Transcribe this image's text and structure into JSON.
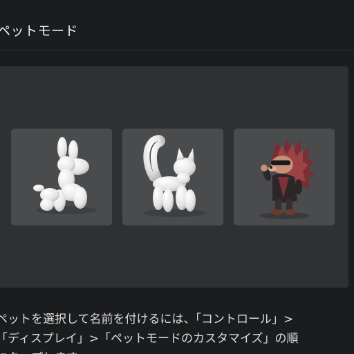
{
  "header": {
    "title": "ペットモード"
  },
  "pets": [
    {
      "id": "dog",
      "icon": "balloon-dog-pet-icon"
    },
    {
      "id": "cat",
      "icon": "balloon-cat-pet-icon"
    },
    {
      "id": "hedgehog",
      "icon": "hedgehog-character-pet-icon"
    }
  ],
  "description": {
    "line1": "ペットを選択して名前を付けるには、「コントロール」>",
    "line2": "「ディスプレイ」>「ペットモードのカスタマイズ」の順",
    "line3": "にタップします。"
  },
  "colors": {
    "background": "#1b1c1e",
    "panel": "#2f3032",
    "card": "#4a4b4d",
    "balloon": "#f2f2f2",
    "hedgehog_spikes": "#8a3a3a"
  }
}
